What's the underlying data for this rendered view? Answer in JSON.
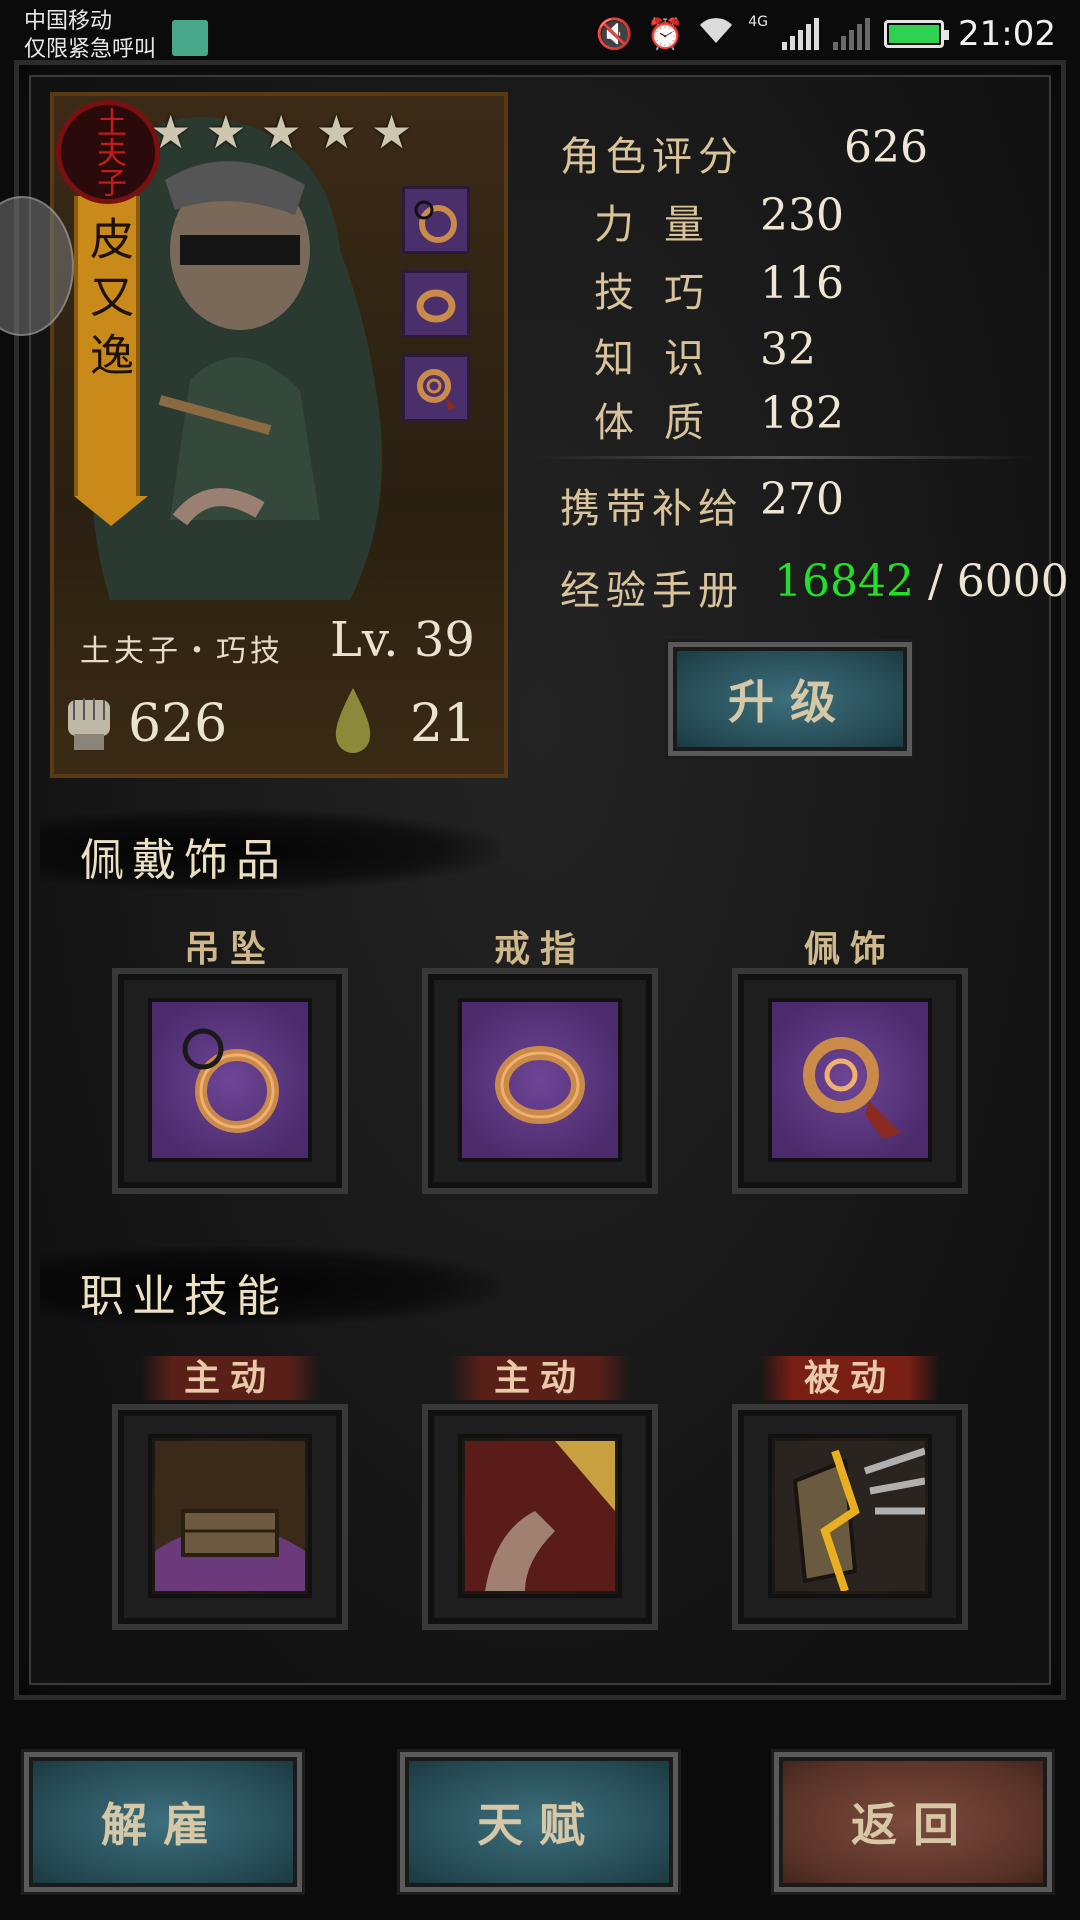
{
  "status_bar": {
    "carrier_line1": "中国移动",
    "carrier_line2": "仅限紧急呼叫",
    "network": "4G",
    "time": "21:02",
    "battery_level": 1.0,
    "icons": [
      "mute-icon",
      "alarm-icon",
      "wifi-icon",
      "signal-icon",
      "battery-icon"
    ]
  },
  "hero": {
    "name": "皮又逸",
    "seal_text": "土夫子",
    "stars": 5,
    "class_label": "土夫子・巧技",
    "level": "Lv. 39",
    "power": "626",
    "stress": "21"
  },
  "stats": {
    "rating_label": "角色评分",
    "rating_value": "626",
    "strength_label": "力量",
    "strength_value": "230",
    "skill_label": "技巧",
    "skill_value": "116",
    "knowledge_label": "知识",
    "knowledge_value": "32",
    "constitution_label": "体质",
    "constitution_value": "182",
    "supply_label": "携带补给",
    "supply_value": "270",
    "exp_label": "经验手册",
    "exp_current": "16842",
    "exp_separator": " / ",
    "exp_required": "6000",
    "exp_current_color": "#22e02a"
  },
  "upgrade_button": "升级",
  "accessories": {
    "title": "佩戴饰品",
    "slots": [
      {
        "label": "吊坠",
        "icon": "pendant-icon"
      },
      {
        "label": "戒指",
        "icon": "ring-icon"
      },
      {
        "label": "佩饰",
        "icon": "ornament-icon"
      }
    ]
  },
  "skills": {
    "title": "职业技能",
    "slots": [
      {
        "label": "主动",
        "icon": "coffin-skill-icon"
      },
      {
        "label": "主动",
        "icon": "strike-skill-icon"
      },
      {
        "label": "被动",
        "icon": "shield-skill-icon"
      }
    ]
  },
  "bottom_buttons": {
    "dismiss": "解雇",
    "talent": "天赋",
    "back": "返回"
  },
  "colors": {
    "accent_gold": "#c98a1a",
    "item_purple": "#4b2b6c",
    "button_blue": "#254a54",
    "button_red": "#5a3328"
  }
}
